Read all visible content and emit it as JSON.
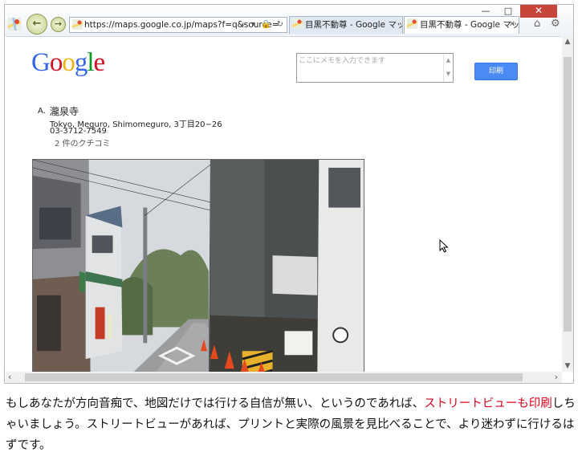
{
  "browser": {
    "window_controls": {
      "minimize": "—",
      "maximize": "□",
      "close": "✕"
    },
    "address_bar": {
      "url": "https://maps.google.co.jp/maps?f=q&source=",
      "controls": "⌕ ▾ 🔒 ↻"
    },
    "tabs": [
      {
        "label": "目黒不動尊 - Google マップ"
      },
      {
        "label": "目黒不動尊 - Google マップ",
        "close": "✕"
      }
    ],
    "tools": {
      "home": "⌂",
      "settings": "⚙"
    }
  },
  "page": {
    "logo": [
      "G",
      "o",
      "o",
      "g",
      "l",
      "e"
    ],
    "logo_colors": [
      "#3369e8",
      "#d50f25",
      "#eeb211",
      "#3369e8",
      "#009925",
      "#d50f25"
    ],
    "memo": {
      "placeholder": "ここにメモを入力できます"
    },
    "print_button": "印刷",
    "place": {
      "marker": "A.",
      "name": "瀧泉寺",
      "address": "Tokyo, Meguro, Shimomeguro, 3丁目20−26",
      "phone": "03-3712-7549",
      "reviews": "2 件のクチコミ"
    }
  },
  "caption": {
    "part1": "もしあなたが方向音痴で、地図だけでは行ける自信が無い、というのであれば、",
    "highlight": "ストリートビューも印刷",
    "part2": "しちゃいましょう。ストリートビューがあれば、プリントと実際の風景を見比べることで、より迷わずに行けるはずです。"
  }
}
